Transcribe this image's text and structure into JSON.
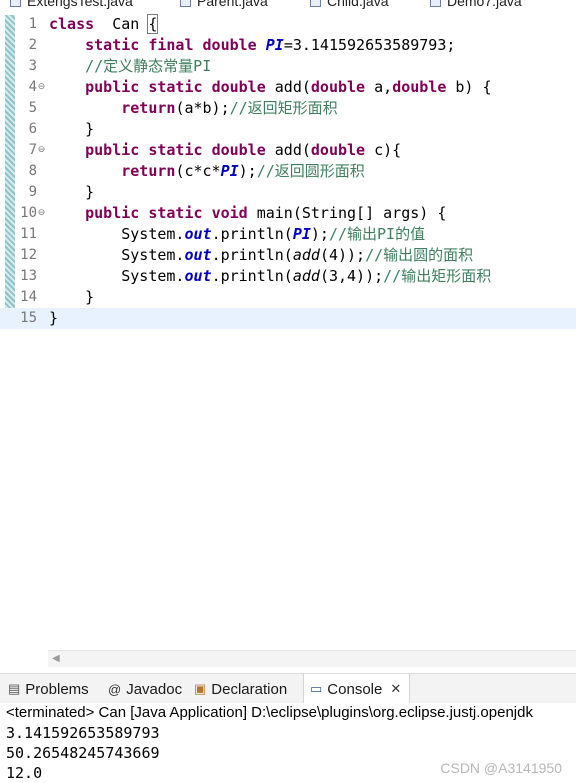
{
  "editor_tabs": [
    "ExtengsTest.java",
    "Parent.java",
    "Child.java",
    "Demo7.java"
  ],
  "code_lines": [
    {
      "n": "1",
      "fold": "",
      "parts": [
        [
          "kw",
          "class"
        ],
        [
          "",
          "  Can "
        ],
        [
          "brace",
          "{"
        ]
      ]
    },
    {
      "n": "2",
      "fold": "",
      "parts": [
        [
          "",
          "    "
        ],
        [
          "kw",
          "static"
        ],
        [
          "",
          " "
        ],
        [
          "kw",
          "final"
        ],
        [
          "",
          " "
        ],
        [
          "kw",
          "double"
        ],
        [
          "",
          " "
        ],
        [
          "sfld",
          "PI"
        ],
        [
          "",
          "=3.141592653589793;"
        ]
      ]
    },
    {
      "n": "3",
      "fold": "",
      "parts": [
        [
          "",
          "    "
        ],
        [
          "cm",
          "//定义静态常量PI"
        ]
      ]
    },
    {
      "n": "4",
      "fold": "⊖",
      "parts": [
        [
          "",
          "    "
        ],
        [
          "kw",
          "public"
        ],
        [
          "",
          " "
        ],
        [
          "kw",
          "static"
        ],
        [
          "",
          " "
        ],
        [
          "kw",
          "double"
        ],
        [
          "",
          " add("
        ],
        [
          "kw",
          "double"
        ],
        [
          "",
          " a,"
        ],
        [
          "kw",
          "double"
        ],
        [
          "",
          " b) {"
        ]
      ]
    },
    {
      "n": "5",
      "fold": "",
      "parts": [
        [
          "",
          "        "
        ],
        [
          "kw",
          "return"
        ],
        [
          "",
          "(a*b);"
        ],
        [
          "cm",
          "//返回矩形面积"
        ]
      ]
    },
    {
      "n": "6",
      "fold": "",
      "parts": [
        [
          "",
          "    }"
        ]
      ]
    },
    {
      "n": "7",
      "fold": "⊖",
      "parts": [
        [
          "",
          "    "
        ],
        [
          "kw",
          "public"
        ],
        [
          "",
          " "
        ],
        [
          "kw",
          "static"
        ],
        [
          "",
          " "
        ],
        [
          "kw",
          "double"
        ],
        [
          "",
          " add("
        ],
        [
          "kw",
          "double"
        ],
        [
          "",
          " c){"
        ]
      ]
    },
    {
      "n": "8",
      "fold": "",
      "parts": [
        [
          "",
          "        "
        ],
        [
          "kw",
          "return"
        ],
        [
          "",
          "(c*c*"
        ],
        [
          "sfld",
          "PI"
        ],
        [
          "",
          ");"
        ],
        [
          "cm",
          "//返回圆形面积"
        ]
      ]
    },
    {
      "n": "9",
      "fold": "",
      "parts": [
        [
          "",
          "    }"
        ]
      ]
    },
    {
      "n": "10",
      "fold": "⊖",
      "parts": [
        [
          "",
          "    "
        ],
        [
          "kw",
          "public"
        ],
        [
          "",
          " "
        ],
        [
          "kw",
          "static"
        ],
        [
          "",
          " "
        ],
        [
          "kw",
          "void"
        ],
        [
          "",
          " main(String[] args) {"
        ]
      ]
    },
    {
      "n": "11",
      "fold": "",
      "parts": [
        [
          "",
          "        System."
        ],
        [
          "fld",
          "out"
        ],
        [
          "",
          ".println("
        ],
        [
          "sfld",
          "PI"
        ],
        [
          "",
          ");"
        ],
        [
          "cm",
          "//输出PI的值"
        ]
      ]
    },
    {
      "n": "12",
      "fold": "",
      "parts": [
        [
          "",
          "        System."
        ],
        [
          "fld",
          "out"
        ],
        [
          "",
          ".println("
        ],
        [
          "sm",
          "add"
        ],
        [
          "",
          "(4));"
        ],
        [
          "cm",
          "//输出圆的面积"
        ]
      ]
    },
    {
      "n": "13",
      "fold": "",
      "parts": [
        [
          "",
          "        System."
        ],
        [
          "fld",
          "out"
        ],
        [
          "",
          ".println("
        ],
        [
          "sm",
          "add"
        ],
        [
          "",
          "(3,4));"
        ],
        [
          "cm",
          "//输出矩形面积"
        ]
      ]
    },
    {
      "n": "14",
      "fold": "",
      "parts": [
        [
          "",
          "    }"
        ]
      ]
    },
    {
      "n": "15",
      "fold": "",
      "parts": [
        [
          "",
          "}"
        ]
      ]
    }
  ],
  "view_tabs": {
    "problems": "Problems",
    "javadoc": "Javadoc",
    "declaration": "Declaration",
    "console": "Console"
  },
  "console": {
    "header": "<terminated> Can [Java Application] D:\\eclipse\\plugins\\org.eclipse.justj.openjdk",
    "output": [
      "3.141592653589793",
      "50.26548245743669",
      "12.0"
    ]
  },
  "watermark": "CSDN @A3141950"
}
